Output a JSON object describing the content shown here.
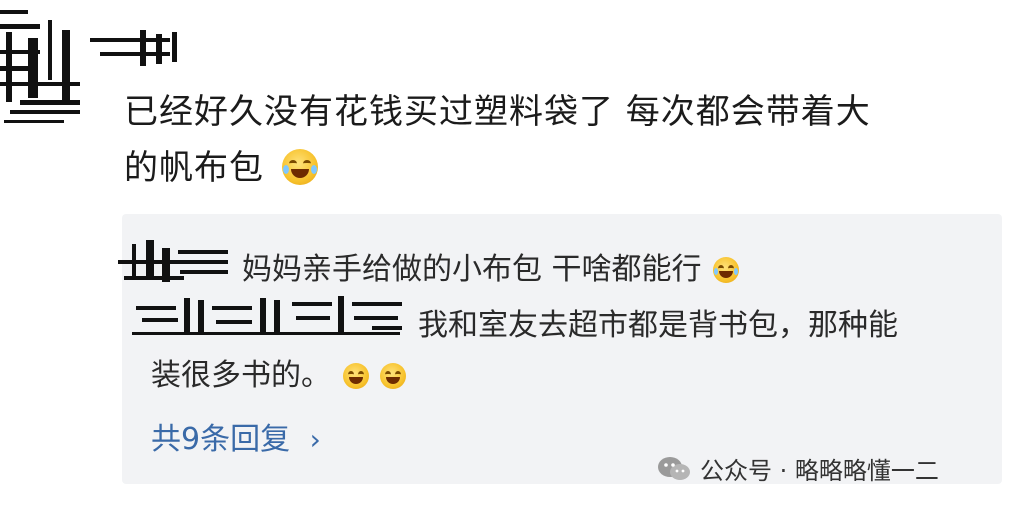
{
  "comment": {
    "line1": "已经好久没有花钱买过塑料袋了 每次都会带着大",
    "line2": "的帆布包",
    "emoji": "laugh-cry-emoji"
  },
  "replies": [
    {
      "text": "妈妈亲手给做的小布包 干啥都能行",
      "emoji": "laugh-cry-emoji"
    },
    {
      "text_line1": "我和室友去超市都是背书包，那种能",
      "text_line2": "装很多书的。",
      "emoji": "laugh-emoji"
    }
  ],
  "reply_count": "共9条回复",
  "watermark": {
    "label": "公众号 · 略略略懂一二",
    "icon": "wechat-icon"
  },
  "colors": {
    "link": "#3a6aa8",
    "panel_bg": "#f2f3f5"
  }
}
